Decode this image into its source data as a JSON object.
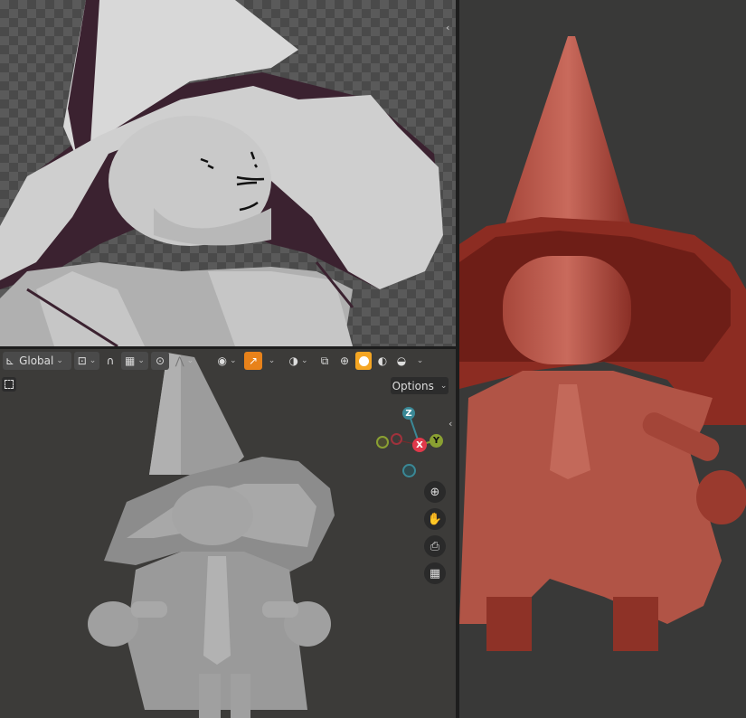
{
  "toolbar": {
    "transform_orientation": "Global",
    "options_label": "Options"
  },
  "gizmo": {
    "z_label": "Z",
    "x_label": "X",
    "y_label": "Y"
  },
  "colors": {
    "background_dark": "#303030",
    "shading_active": "#f5a623",
    "snap_active": "#e8821a",
    "clay_model": "#9a9a9a",
    "red_model": "#9b3a30",
    "gizmo_x": "#e0384a",
    "gizmo_y": "#8aa032",
    "gizmo_z": "#3a8896"
  },
  "icons": {
    "transform_pivot": "pivot-icon",
    "snap": "magnet-icon",
    "proportional": "proportional-edit-icon",
    "overlays": "overlay-icon",
    "xray": "xray-icon",
    "zoom": "zoom-icon",
    "pan": "hand-icon",
    "camera": "camera-icon",
    "perspective": "grid-icon"
  }
}
